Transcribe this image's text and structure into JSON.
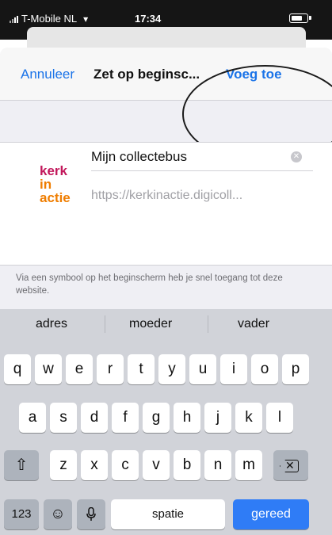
{
  "status_bar": {
    "carrier": "T-Mobile NL",
    "time": "17:34"
  },
  "navbar": {
    "cancel_label": "Annuleer",
    "title": "Zet op beginsc...",
    "add_label": "Voeg toe"
  },
  "bookmark": {
    "logo_line1": "kerk",
    "logo_line2": "in actie",
    "name_value": "Mijn collectebus",
    "url": "https://kerkinactie.digicoll..."
  },
  "info_text": "Via een symbool op het beginscherm heb je snel toegang tot deze website.",
  "suggestions": [
    "adres",
    "moeder",
    "vader"
  ],
  "keyboard": {
    "row1": [
      "q",
      "w",
      "e",
      "r",
      "t",
      "y",
      "u",
      "i",
      "o",
      "p"
    ],
    "row2": [
      "a",
      "s",
      "d",
      "f",
      "g",
      "h",
      "j",
      "k",
      "l"
    ],
    "row3": [
      "z",
      "x",
      "c",
      "v",
      "b",
      "n",
      "m"
    ],
    "numbers_label": "123",
    "space_label": "spatie",
    "done_label": "gereed"
  },
  "colors": {
    "accent": "#1a73e8",
    "done_key": "#2f7cf6",
    "logo_primary": "#c2185b",
    "logo_secondary": "#ef7d00"
  },
  "icons": [
    "signal-icon",
    "wifi-icon",
    "battery-icon",
    "clear-icon",
    "shift-icon",
    "backspace-icon",
    "emoji-icon",
    "microphone-icon"
  ]
}
